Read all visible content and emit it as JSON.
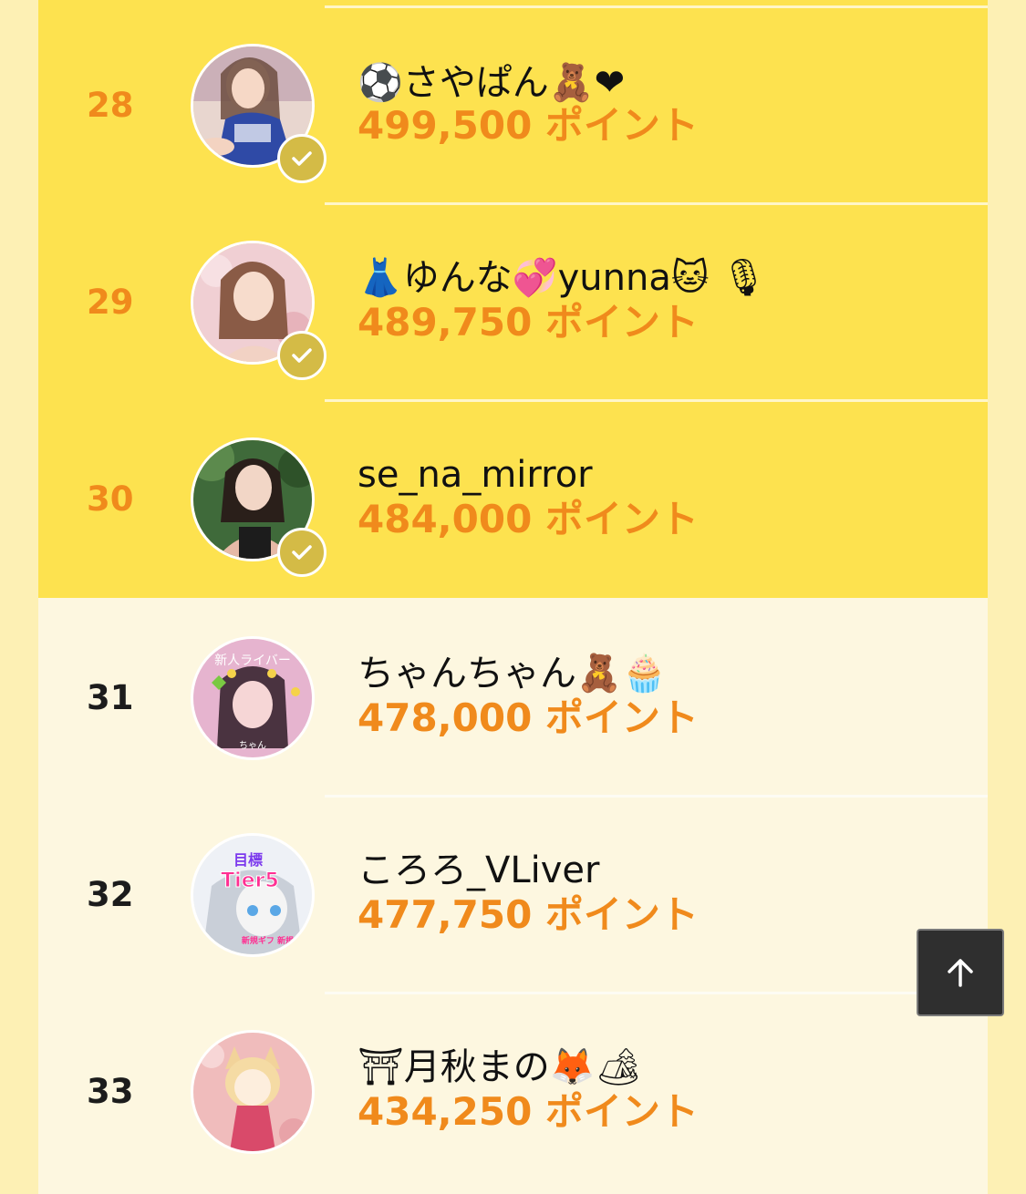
{
  "ranking": {
    "unit": "ポイント",
    "items": [
      {
        "rank": "28",
        "name": "⚽さやぱん🧸❤",
        "points": "499,500 ポイント",
        "tier": "top",
        "verified": true
      },
      {
        "rank": "29",
        "name": "👗ゆんな💞yunna🐱 🎙",
        "points": "489,750 ポイント",
        "tier": "top",
        "verified": true
      },
      {
        "rank": "30",
        "name": "se_na_mirror",
        "points": "484,000 ポイント",
        "tier": "top",
        "verified": true
      },
      {
        "rank": "31",
        "name": "ちゃんちゃん🧸🧁",
        "points": "478,000 ポイント",
        "tier": "normal",
        "verified": false
      },
      {
        "rank": "32",
        "name": "ころろ_VLiver",
        "points": "477,750 ポイント",
        "tier": "normal",
        "verified": false
      },
      {
        "rank": "33",
        "name": "⛩月秋まの🦊🏕",
        "points": "434,250 ポイント",
        "tier": "normal",
        "verified": false
      }
    ]
  },
  "avatars": {
    "a28": {
      "text": ""
    },
    "a29": {
      "text": ""
    },
    "a30": {
      "text": ""
    },
    "a31": {
      "text": "新人ライバー",
      "sub": "ちゃん"
    },
    "a32": {
      "text": "目標",
      "sub": "Tier5",
      "sub2": "新規ギフ 新規フォロ"
    },
    "a33": {
      "text": ""
    }
  },
  "colors": {
    "top_row_bg": "#fde24f",
    "normal_row_bg": "#fdf7e0",
    "points": "#f08a1c",
    "verified_badge": "#d4bb46",
    "page_bg": "#fdf0b4"
  },
  "icons": {
    "verified": "check-badge-icon",
    "back_to_top": "arrow-up-icon"
  }
}
